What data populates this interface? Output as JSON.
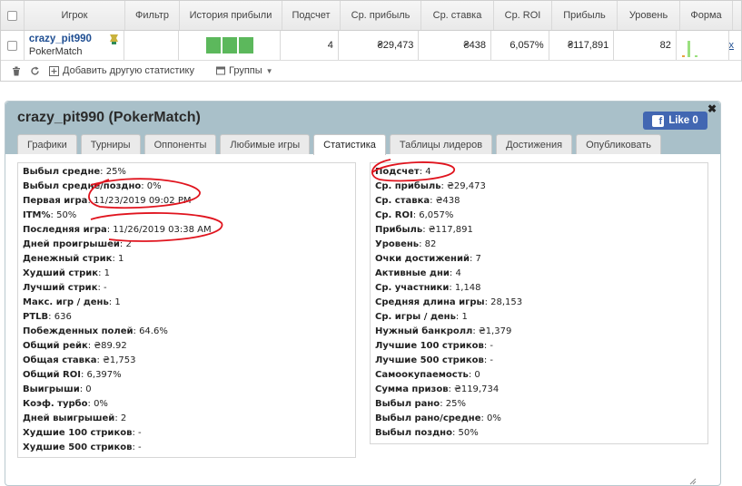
{
  "grid": {
    "headers": [
      "Игрок",
      "Фильтр",
      "История прибыли",
      "Подсчет",
      "Ср. прибыль",
      "Ср. ставка",
      "Ср. ROI",
      "Прибыль",
      "Уровень",
      "Форма"
    ],
    "row": {
      "player_name": "crazy_pit990",
      "site": "PokerMatch",
      "count": "4",
      "avg_profit": "₴29,473",
      "avg_stake": "₴438",
      "avg_roi": "6,057%",
      "profit": "₴117,891",
      "level": "82",
      "remove_label": "x"
    },
    "toolbar": {
      "add_stat_label": "Добавить другую статистику",
      "groups_label": "Группы"
    }
  },
  "panel": {
    "title": "crazy_pit990 (PokerMatch)",
    "like_label": "Like 0",
    "tabs": [
      "Графики",
      "Турниры",
      "Оппоненты",
      "Любимые игры",
      "Статистика",
      "Таблицы лидеров",
      "Достижения",
      "Опубликовать"
    ],
    "active_tab": "Статистика",
    "left_stats": [
      {
        "k": "Выбыл средне",
        "v": "25%"
      },
      {
        "k": "Выбыл средне/поздно",
        "v": "0%"
      },
      {
        "k": "Первая игра",
        "v": "11/23/2019 09:02 PM"
      },
      {
        "k": "ITM%",
        "v": "50%"
      },
      {
        "k": "Последняя игра",
        "v": "11/26/2019 03:38 AM"
      },
      {
        "k": "Дней проигрышей",
        "v": "2"
      },
      {
        "k": "Денежный стрик",
        "v": "1"
      },
      {
        "k": "Худший стрик",
        "v": "1"
      },
      {
        "k": "Лучший стрик",
        "v": "-"
      },
      {
        "k": "Макс. игр / день",
        "v": "1"
      },
      {
        "k": "PTLB",
        "v": "636"
      },
      {
        "k": "Побежденных полей",
        "v": "64.6%"
      },
      {
        "k": "Общий рейк",
        "v": "₴89.92"
      },
      {
        "k": "Общая ставка",
        "v": "₴1,753"
      },
      {
        "k": "Общий ROI",
        "v": "6,397%"
      },
      {
        "k": "Выигрыши",
        "v": "0"
      },
      {
        "k": "Коэф. турбо",
        "v": "0%"
      },
      {
        "k": "Дней выигрышей",
        "v": "2"
      },
      {
        "k": "Худшие 100 стриков",
        "v": "-"
      },
      {
        "k": "Худшие 500 стриков",
        "v": "-"
      }
    ],
    "right_stats": [
      {
        "k": "Подсчет",
        "v": "4"
      },
      {
        "k": "Ср. прибыль",
        "v": "₴29,473"
      },
      {
        "k": "Ср. ставка",
        "v": "₴438"
      },
      {
        "k": "Ср. ROI",
        "v": "6,057%"
      },
      {
        "k": "Прибыль",
        "v": "₴117,891"
      },
      {
        "k": "Уровень",
        "v": "82"
      },
      {
        "k": "Очки достижений",
        "v": "7"
      },
      {
        "k": "Активные дни",
        "v": "4"
      },
      {
        "k": "Ср. участники",
        "v": "1,148"
      },
      {
        "k": "Средняя длина игры",
        "v": "28,153"
      },
      {
        "k": "Ср. игры / день",
        "v": "1"
      },
      {
        "k": "Нужный банкролл",
        "v": "₴1,379"
      },
      {
        "k": "Лучшие 100 стриков",
        "v": "-"
      },
      {
        "k": "Лучшие 500 стриков",
        "v": "-"
      },
      {
        "k": "Самоокупаемость",
        "v": "0"
      },
      {
        "k": "Сумма призов",
        "v": "₴119,734"
      },
      {
        "k": "Выбыл рано",
        "v": "25%"
      },
      {
        "k": "Выбыл рано/средне",
        "v": "0%"
      },
      {
        "k": "Выбыл поздно",
        "v": "50%"
      }
    ]
  },
  "colors": {
    "history_bar": "#5cb85c",
    "panel_header": "#a9c0c9",
    "facebook": "#4267b2",
    "annotation": "#e0141e",
    "link": "#1f4e92"
  },
  "icons": [
    "trash-icon",
    "refresh-icon",
    "add-stat-icon",
    "groups-icon",
    "badge-icon",
    "close-icon"
  ]
}
